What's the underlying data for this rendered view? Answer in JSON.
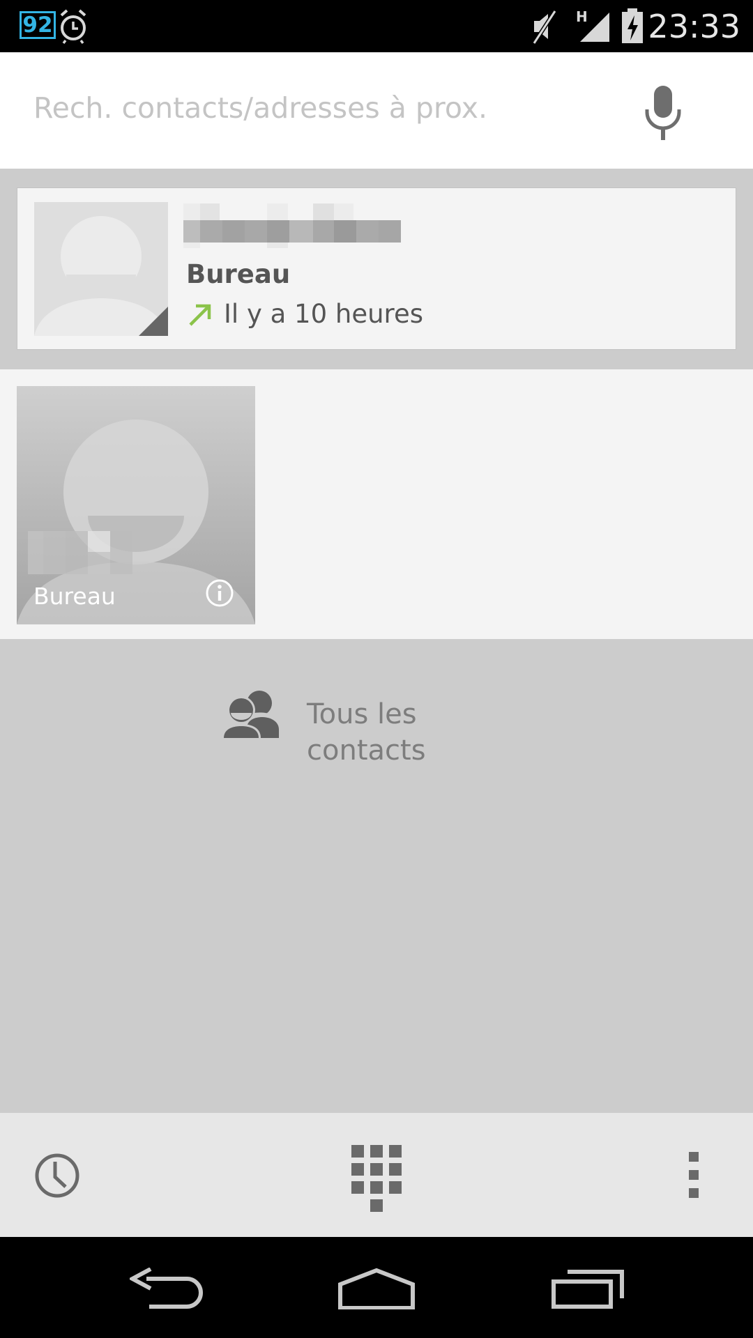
{
  "status_bar": {
    "battery_percent": "92",
    "time": "23:33",
    "network_type": "H",
    "icons": [
      "battery-percent-icon",
      "alarm-icon",
      "mute-icon",
      "signal-icon",
      "battery-charging-icon"
    ]
  },
  "search": {
    "placeholder": "Rech. contacts/adresses à prox.",
    "value": "",
    "mic_icon": "microphone-icon"
  },
  "recent_call": {
    "contact_name": "",
    "label": "Bureau",
    "call_type_icon": "outgoing-call-icon",
    "time": "Il y a 10 heures"
  },
  "favorites": [
    {
      "label": "Bureau",
      "info_icon": "info-icon"
    }
  ],
  "all_contacts": {
    "label": "Tous les contacts",
    "icon": "people-icon"
  },
  "action_bar": {
    "icons": [
      "history-clock-icon",
      "dialpad-icon",
      "overflow-menu-icon"
    ]
  },
  "nav_bar": {
    "icons": [
      "back-icon",
      "home-icon",
      "recent-apps-icon"
    ]
  },
  "colors": {
    "accent_blue": "#33b5e5",
    "outgoing_green": "#8bc34a",
    "background_gray": "#cccccc",
    "card_bg": "#f4f4f4"
  }
}
